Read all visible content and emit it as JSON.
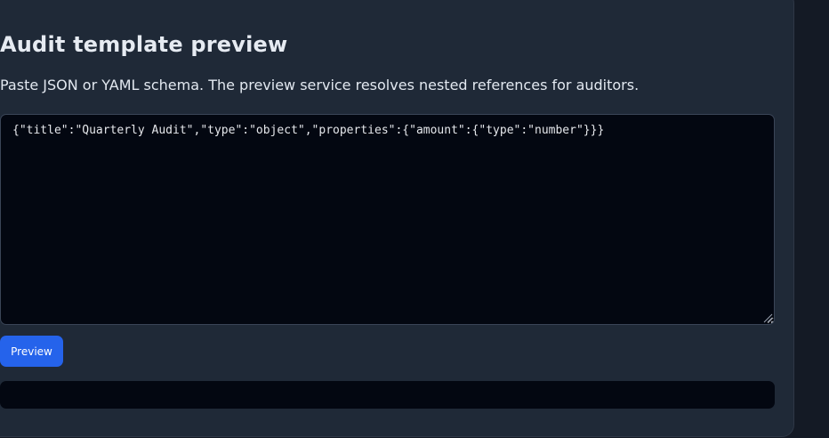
{
  "page": {
    "title": "Audit template preview",
    "description": "Paste JSON or YAML schema. The preview service resolves nested references for auditors."
  },
  "editor": {
    "value": "{\"title\":\"Quarterly Audit\",\"type\":\"object\",\"properties\":{\"amount\":{\"type\":\"number\"}}}"
  },
  "actions": {
    "preview_label": "Preview"
  },
  "output": {
    "text": ""
  },
  "colors": {
    "accent": "#2563eb",
    "panel_bg": "#1f2937",
    "editor_bg": "#030711",
    "page_bg": "#141a25"
  }
}
